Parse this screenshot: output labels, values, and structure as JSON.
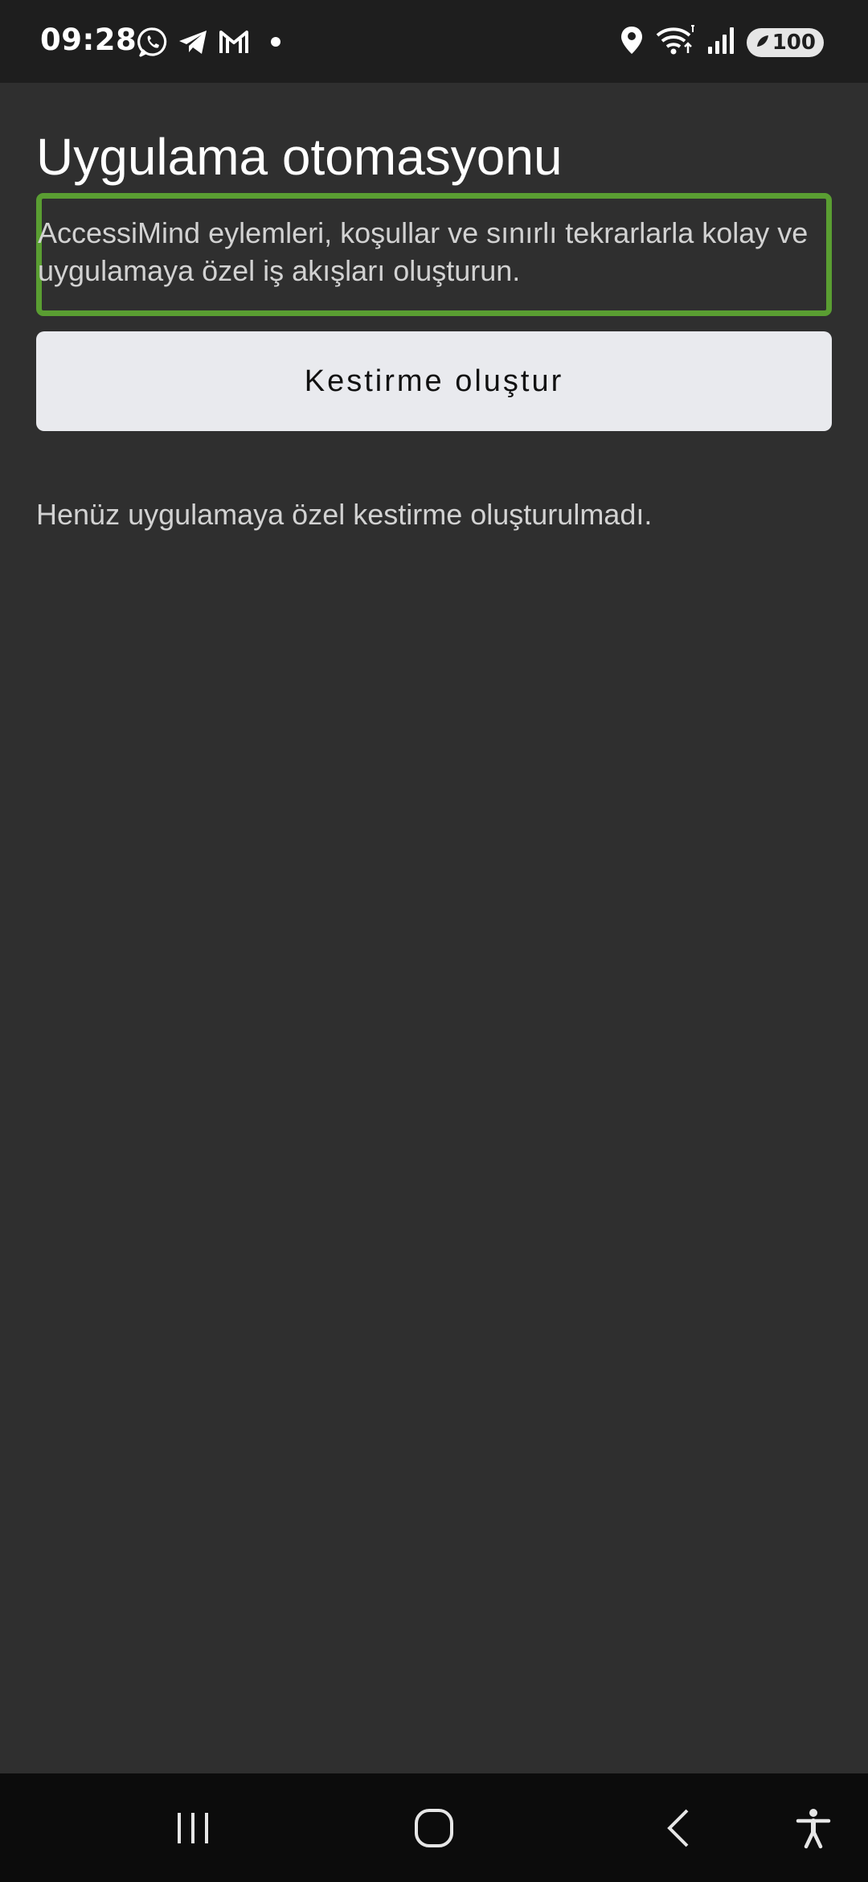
{
  "status_bar": {
    "time": "09:28",
    "left_icons": [
      "whatsapp-icon",
      "telegram-icon",
      "gmail-icon",
      "notification-dot-icon"
    ],
    "right_icons": [
      "location-icon",
      "wifi-icon",
      "signal-icon"
    ],
    "battery_level": "100"
  },
  "main": {
    "title": "Uygulama otomasyonu",
    "description": "AccessiMind eylemleri, koşullar ve sınırlı tekrarlarla kolay ve uygulamaya özel iş akışları oluşturun.",
    "create_button_label": "Kestirme oluştur",
    "empty_message": "Henüz uygulamaya özel kestirme oluşturulmadı."
  },
  "nav_bar": {
    "buttons": [
      "recents-icon",
      "home-icon",
      "back-icon",
      "accessibility-icon"
    ]
  },
  "colors": {
    "background": "#2f2f2f",
    "status_bar": "#1e1e1e",
    "nav_bar": "#0c0c0c",
    "highlight_border": "#5a9e32",
    "button_bg": "#e9eaee"
  }
}
